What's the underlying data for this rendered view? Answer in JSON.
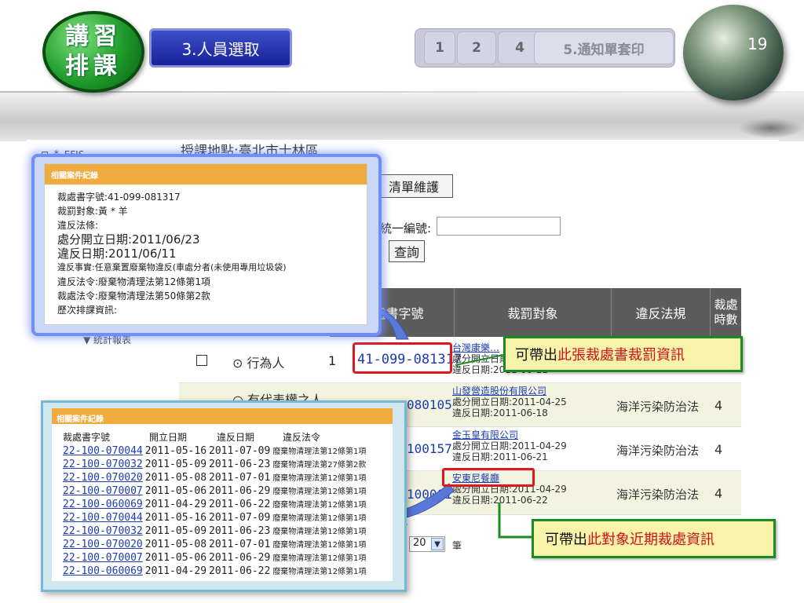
{
  "slide": {
    "logo_line1": "講習",
    "logo_line2": "排課",
    "step_label": "3.人員選取",
    "nav_steps": [
      "1",
      "2",
      "4",
      "5.通知單套印"
    ],
    "page_number": "19"
  },
  "app": {
    "tree_label": "EFIS",
    "location_title": "授課地點:臺北市士林區",
    "maintain_button": "清單維護",
    "taxid_label": "統一編號:",
    "query_button": "查詢",
    "stats_label": "統計報表",
    "table": {
      "headers": [
        "裁處書字號",
        "裁罰對象",
        "違反法規",
        "裁處時數"
      ],
      "radio_actor": "行為人",
      "radio_representative": "有代表權之人",
      "rows": [
        {
          "no": "1",
          "doc": "41-099-081317",
          "target": "台灣康樂…",
          "opened": "處分開立日期:2011-06-23",
          "violated": "違反日期:2011-06-11",
          "law": "",
          "hours": ""
        },
        {
          "no": "",
          "doc": "080105",
          "target": "山發營造股份有限公司",
          "opened": "處分開立日期:2011-04-25",
          "violated": "違反日期:2011-06-18",
          "law": "海洋污染防治法",
          "hours": "4"
        },
        {
          "no": "",
          "doc": "100157",
          "target": "金玉皇有限公司",
          "opened": "處分開立日期:2011-04-29",
          "violated": "違反日期:2011-06-21",
          "law": "海洋污染防治法",
          "hours": "4"
        },
        {
          "no": "",
          "doc": "100001",
          "target": "安東尼餐廳",
          "opened": "處分開立日期:2011-04-29",
          "violated": "違反日期:2011-06-22",
          "law": "海洋污染防治法",
          "hours": "4"
        }
      ]
    },
    "pager_value": "20",
    "pager_unit": "筆"
  },
  "callouts": {
    "c1_black": "可帶出",
    "c1_red": "此張裁處書裁罰資訊",
    "c2_black": "可帶出",
    "c2_red": "此對象近期裁處資訊"
  },
  "popup_case": {
    "header": "相關案件紀錄",
    "doc_no": "裁處書字號:41-099-081317",
    "target": "裁罰對象:黃 * 羊",
    "law": "違反法條:",
    "opened": "處分開立日期:2011/06/23",
    "violated": "違反日期:2011/06/11",
    "facts": "違反事實:任意棄置廢棄物違反(車處分者(未使用專用垃圾袋)",
    "law_violated": "違反法令:廢棄物清理法第12條第1項",
    "law_penalty": "裁處法令:廢棄物清理法第50條第2款",
    "history": "歷次排課資訊:"
  },
  "popup_recent": {
    "header": "相關案件紀錄",
    "col_doc": "裁處書字號",
    "col_open": "開立日期",
    "col_violate": "違反日期",
    "col_law": "違反法令",
    "rows": [
      {
        "doc": "22-100-070044",
        "open": "2011-05-16",
        "violate": "2011-07-09",
        "law": "廢棄物清理法第12條第1項"
      },
      {
        "doc": "22-100-070032",
        "open": "2011-05-09",
        "violate": "2011-06-23",
        "law": "廢棄物清理法第27條第2款"
      },
      {
        "doc": "22-100-070020",
        "open": "2011-05-08",
        "violate": "2011-07-01",
        "law": "廢棄物清理法第12條第1項"
      },
      {
        "doc": "22-100-070007",
        "open": "2011-05-06",
        "violate": "2011-06-29",
        "law": "廢棄物清理法第12條第1項"
      },
      {
        "doc": "22-100-060069",
        "open": "2011-04-29",
        "violate": "2011-06-22",
        "law": "廢棄物清理法第12條第1項"
      },
      {
        "doc": "22-100-070044",
        "open": "2011-05-16",
        "violate": "2011-07-09",
        "law": "廢棄物清理法第12條第1項"
      },
      {
        "doc": "22-100-070032",
        "open": "2011-05-09",
        "violate": "2011-06-23",
        "law": "廢棄物清理法第12條第1項"
      },
      {
        "doc": "22-100-070020",
        "open": "2011-05-08",
        "violate": "2011-07-01",
        "law": "廢棄物清理法第12條第1項"
      },
      {
        "doc": "22-100-070007",
        "open": "2011-05-06",
        "violate": "2011-06-29",
        "law": "廢棄物清理法第12條第1項"
      },
      {
        "doc": "22-100-060069",
        "open": "2011-04-29",
        "violate": "2011-06-22",
        "law": "廢棄物清理法第12條第1項"
      }
    ]
  },
  "colors": {
    "accent_red": "#d0101a",
    "callout_border": "#1a8b22",
    "popup_header": "#f0ab3f",
    "link_blue": "#1d3bb3"
  }
}
